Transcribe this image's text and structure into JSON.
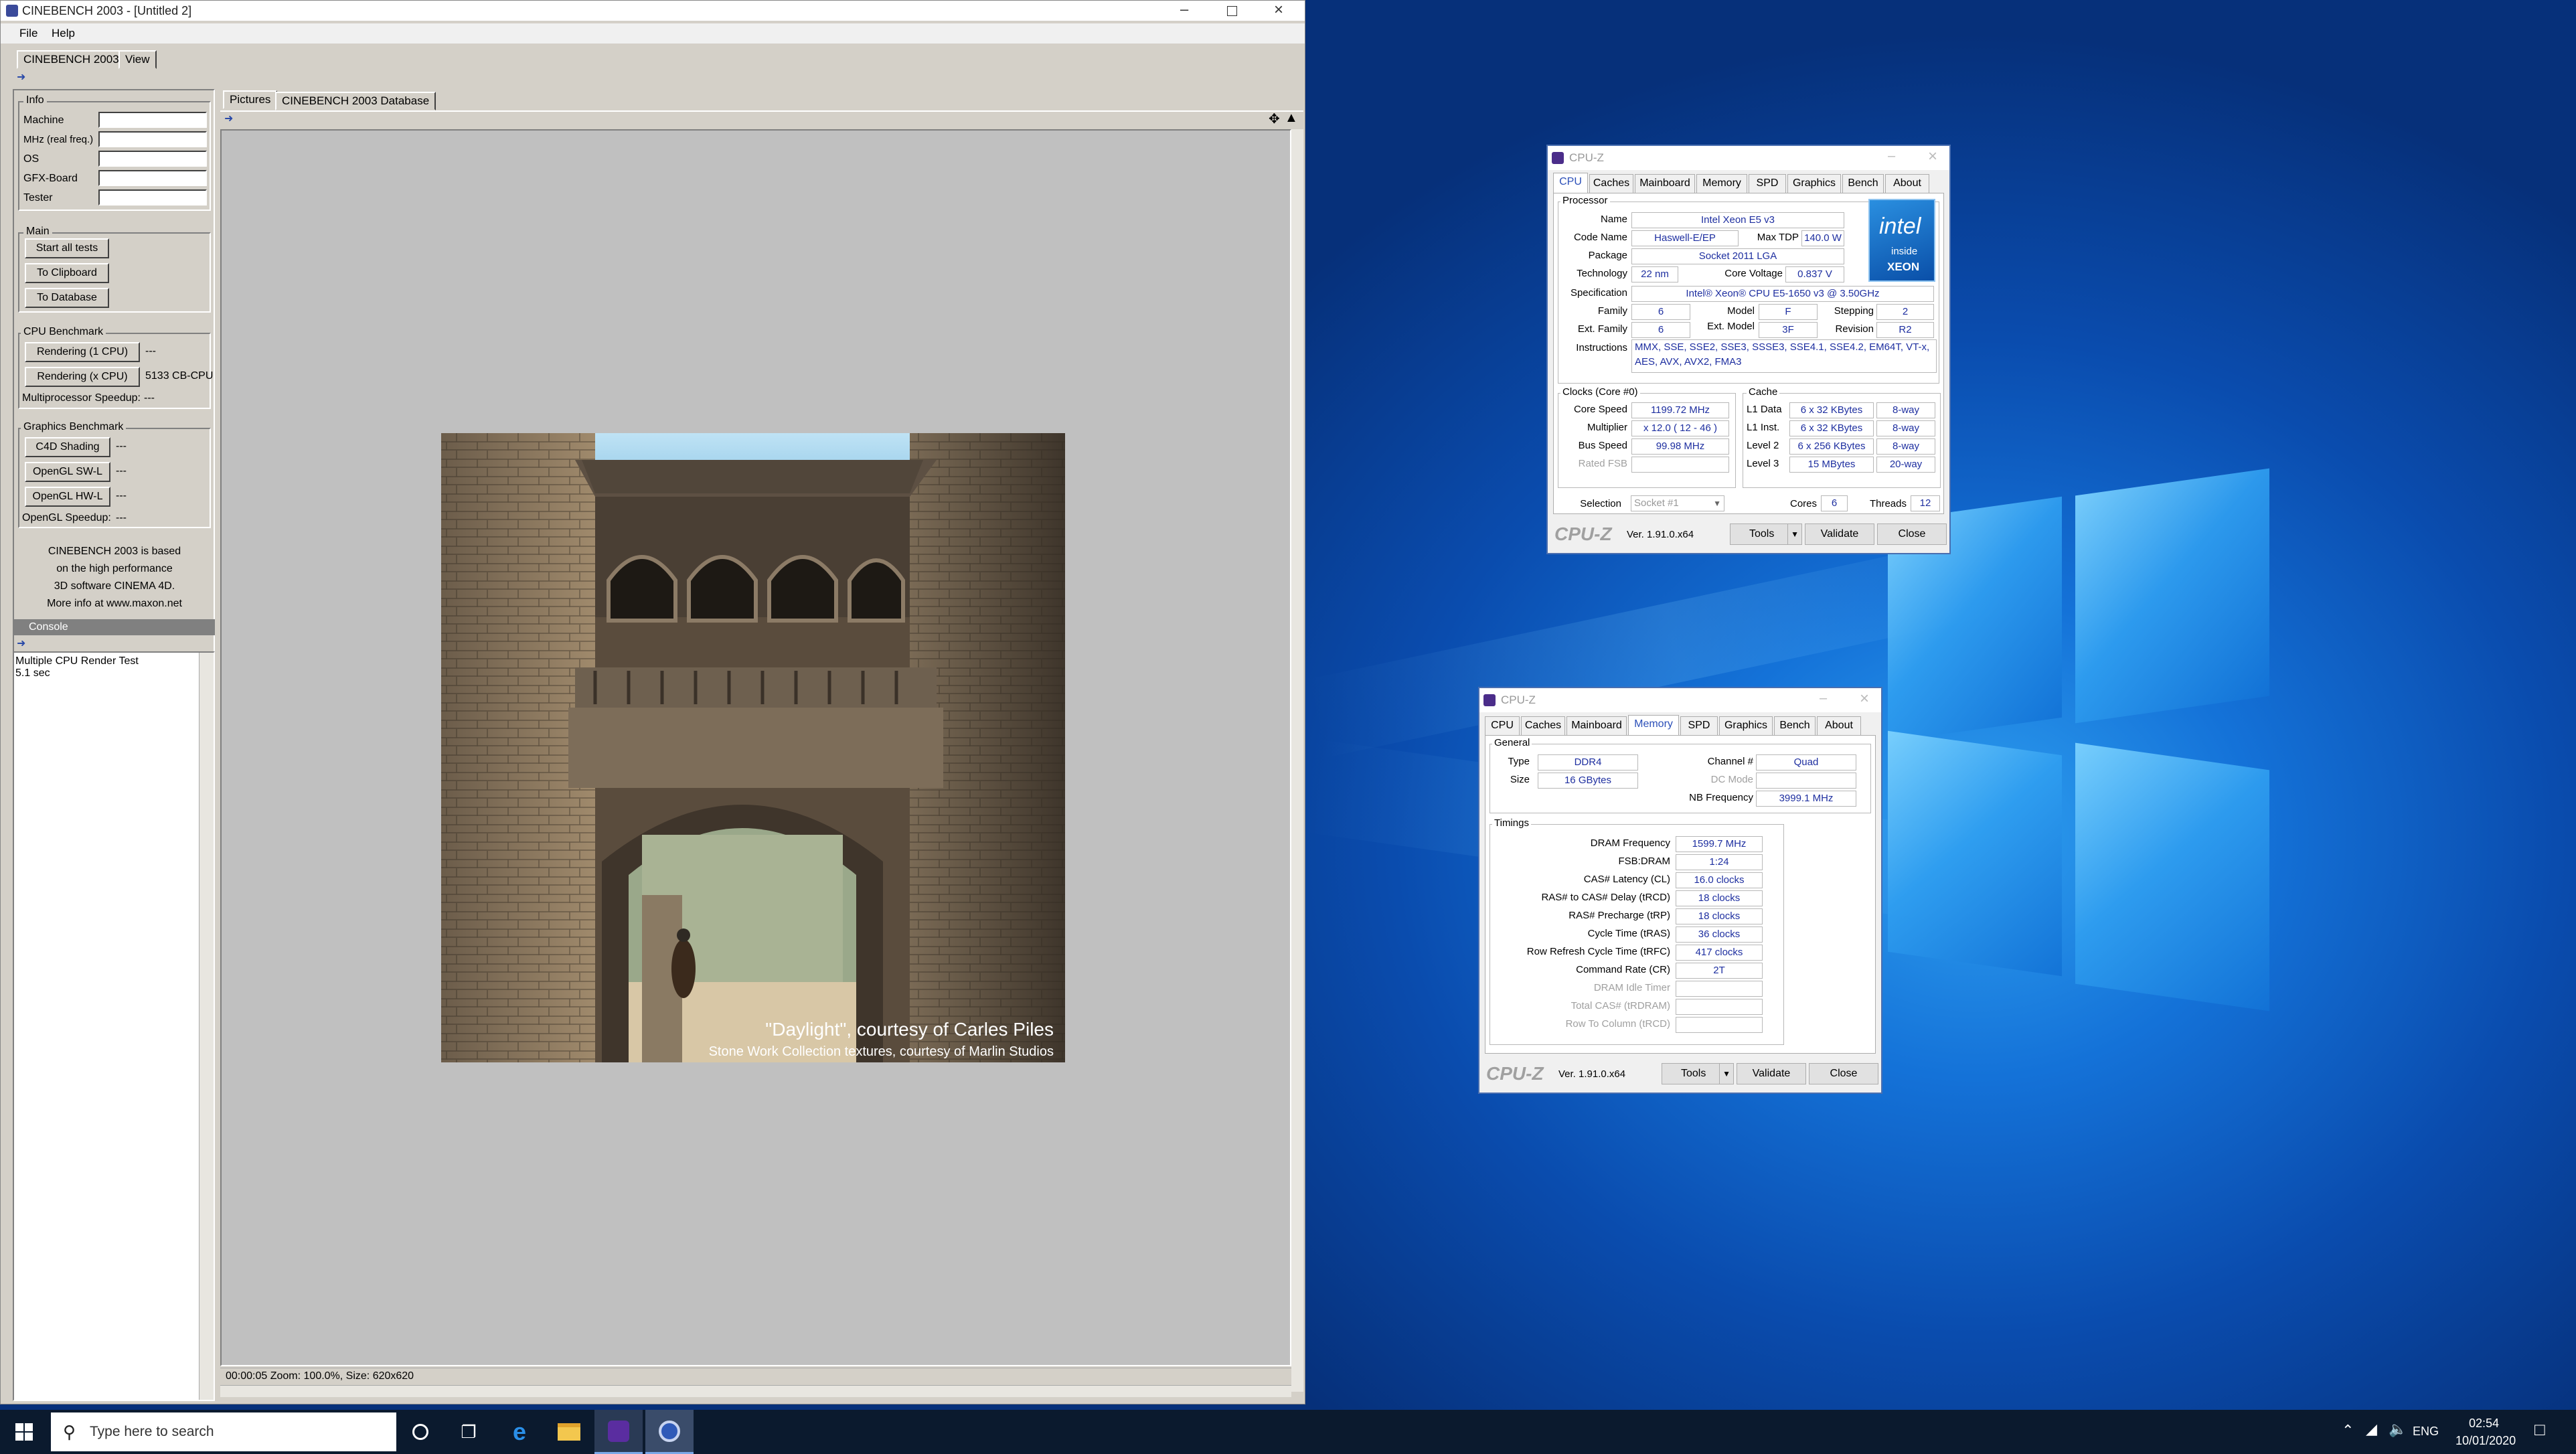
{
  "cinebench": {
    "title": "CINEBENCH 2003 - [Untitled 2]",
    "menu": [
      "File",
      "Help"
    ],
    "tabs": [
      "CINEBENCH 2003",
      "View"
    ],
    "info_group": "Info",
    "info_fields": [
      "Machine",
      "MHz (real freq.)",
      "OS",
      "GFX-Board",
      "Tester"
    ],
    "main_group": "Main",
    "start_all": "Start all tests",
    "to_clipboard": "To Clipboard",
    "to_database": "To Database",
    "cpu_group": "CPU Benchmark",
    "rendering_1cpu": "Rendering (1 CPU)",
    "rendering_1cpu_value": "---",
    "rendering_xcpu": "Rendering (x CPU)",
    "rendering_xcpu_value": "5133 CB-CPU",
    "mp_speedup": "Multiprocessor Speedup:",
    "mp_speedup_value": "---",
    "gfx_group": "Graphics Benchmark",
    "c4d_shading": "C4D Shading",
    "c4d_value": "---",
    "opengl_sw": "OpenGL SW-L",
    "opengl_sw_value": "---",
    "opengl_hw": "OpenGL HW-L",
    "opengl_hw_value": "---",
    "opengl_speedup": "OpenGL Speedup:",
    "opengl_speedup_value": "---",
    "about": [
      "CINEBENCH 2003 is based",
      "on the high performance",
      "3D software CINEMA 4D.",
      "More info at www.maxon.net"
    ],
    "console_title": "Console",
    "console_lines": [
      "Multiple CPU Render Test",
      "5.1 sec"
    ],
    "picture_tabs": [
      "Pictures",
      "CINEBENCH 2003 Database"
    ],
    "caption1": "\"Daylight\", courtesy of Carles Piles",
    "caption2": "Stone Work Collection textures, courtesy of Marlin Studios",
    "status": "00:00:05  Zoom: 100.0%, Size: 620x620"
  },
  "cpuz1": {
    "title": "CPU-Z",
    "tabs": [
      "CPU",
      "Caches",
      "Mainboard",
      "Memory",
      "SPD",
      "Graphics",
      "Bench",
      "About"
    ],
    "processor": "Processor",
    "name_k": "Name",
    "name": "Intel Xeon E5 v3",
    "code_k": "Code Name",
    "code": "Haswell-E/EP",
    "tdp_k": "Max TDP",
    "tdp": "140.0 W",
    "pkg_k": "Package",
    "pkg": "Socket 2011 LGA",
    "tech_k": "Technology",
    "tech": "22 nm",
    "volt_k": "Core Voltage",
    "volt": "0.837 V",
    "spec_k": "Specification",
    "spec": "Intel® Xeon® CPU E5-1650 v3 @ 3.50GHz",
    "fam_k": "Family",
    "fam": "6",
    "model_k": "Model",
    "model": "F",
    "step_k": "Stepping",
    "step": "2",
    "efam_k": "Ext. Family",
    "efam": "6",
    "emodel_k": "Ext. Model",
    "emodel": "3F",
    "rev_k": "Revision",
    "rev": "R2",
    "instr_k": "Instructions",
    "instr1": "MMX, SSE, SSE2, SSE3, SSSE3, SSE4.1, SSE4.2, EM64T, VT-x,",
    "instr2": "AES, AVX, AVX2, FMA3",
    "clocks": "Clocks (Core #0)",
    "cs_k": "Core Speed",
    "cs": "1199.72 MHz",
    "mul_k": "Multiplier",
    "mul": "x 12.0 ( 12 - 46 )",
    "bus_k": "Bus Speed",
    "bus": "99.98 MHz",
    "fsb_k": "Rated FSB",
    "fsb": "",
    "cache": "Cache",
    "l1d_k": "L1 Data",
    "l1d": "6 x 32 KBytes",
    "l1d_w": "8-way",
    "l1i_k": "L1 Inst.",
    "l1i": "6 x 32 KBytes",
    "l1i_w": "8-way",
    "l2_k": "Level 2",
    "l2": "6 x 256 KBytes",
    "l2_w": "8-way",
    "l3_k": "Level 3",
    "l3": "15 MBytes",
    "l3_w": "20-way",
    "sel_k": "Selection",
    "sel": "Socket #1",
    "cores_k": "Cores",
    "cores": "6",
    "threads_k": "Threads",
    "threads": "12",
    "logo": "CPU-Z",
    "ver": "Ver. 1.91.0.x64",
    "tools": "Tools",
    "validate": "Validate",
    "close": "Close",
    "badge_brand": "intel",
    "badge_inside": "inside",
    "badge_xeon": "XEON"
  },
  "cpuz2": {
    "title": "CPU-Z",
    "tabs": [
      "CPU",
      "Caches",
      "Mainboard",
      "Memory",
      "SPD",
      "Graphics",
      "Bench",
      "About"
    ],
    "general": "General",
    "type_k": "Type",
    "type": "DDR4",
    "size_k": "Size",
    "size": "16 GBytes",
    "ch_k": "Channel #",
    "ch": "Quad",
    "dc_k": "DC Mode",
    "dc": "",
    "nb_k": "NB Frequency",
    "nb": "3999.1 MHz",
    "timings": "Timings",
    "rows": [
      {
        "k": "DRAM Frequency",
        "v": "1599.7 MHz"
      },
      {
        "k": "FSB:DRAM",
        "v": "1:24"
      },
      {
        "k": "CAS# Latency (CL)",
        "v": "16.0 clocks"
      },
      {
        "k": "RAS# to CAS# Delay (tRCD)",
        "v": "18 clocks"
      },
      {
        "k": "RAS# Precharge (tRP)",
        "v": "18 clocks"
      },
      {
        "k": "Cycle Time (tRAS)",
        "v": "36 clocks"
      },
      {
        "k": "Row Refresh Cycle Time (tRFC)",
        "v": "417 clocks"
      },
      {
        "k": "Command Rate (CR)",
        "v": "2T"
      },
      {
        "k": "DRAM Idle Timer",
        "v": ""
      },
      {
        "k": "Total CAS# (tRDRAM)",
        "v": ""
      },
      {
        "k": "Row To Column (tRCD)",
        "v": ""
      }
    ],
    "logo": "CPU-Z",
    "ver": "Ver. 1.91.0.x64",
    "tools": "Tools",
    "validate": "Validate",
    "close": "Close"
  },
  "taskbar": {
    "search": "Type here to search",
    "lang": "ENG",
    "time": "02:54",
    "date": "10/01/2020"
  },
  "colors": {
    "desktop": "#0a4fa8",
    "taskbar": "#0b1a2e",
    "cpuz_value": "#1e2fa0",
    "cpuz_tab_active": "#2b4fb8"
  }
}
